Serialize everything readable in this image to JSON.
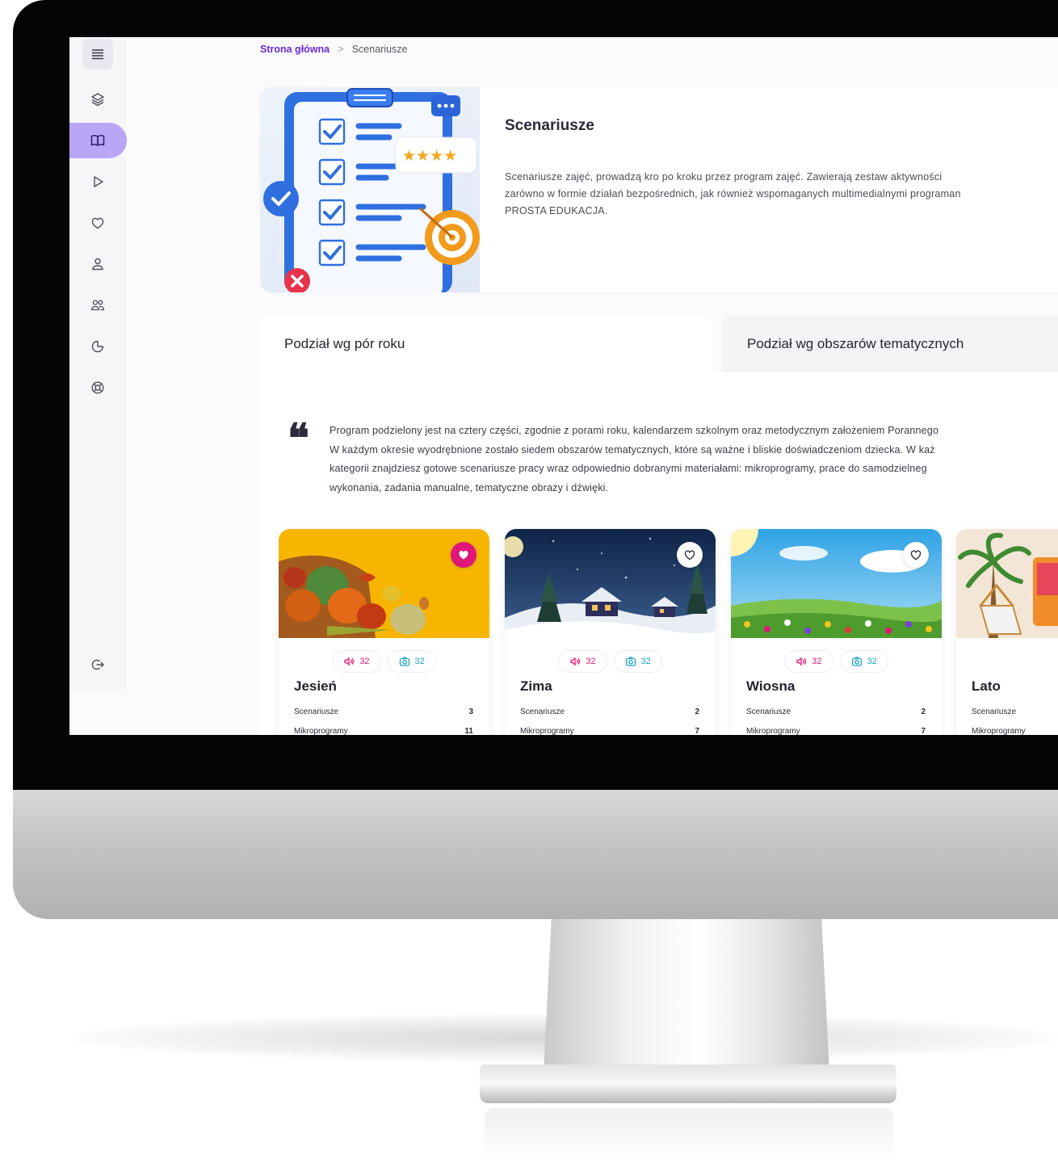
{
  "breadcrumb": {
    "home": "Strona główna",
    "separator": ">",
    "current": "Scenariusze"
  },
  "sidebar": {
    "items": [
      {
        "icon": "menu-icon"
      },
      {
        "icon": "layers-icon"
      },
      {
        "icon": "book-icon",
        "active": true
      },
      {
        "icon": "play-icon"
      },
      {
        "icon": "heart-icon"
      },
      {
        "icon": "user-icon"
      },
      {
        "icon": "users-icon"
      },
      {
        "icon": "pie-chart-icon"
      },
      {
        "icon": "lifebuoy-icon"
      }
    ],
    "logout_icon": "logout-icon",
    "active_color": "#b9a6f4"
  },
  "hero": {
    "title": "Scenariusze",
    "description": "Scenariusze zajęć, prowadzą kro po kroku przez program zajęć. Zawierają zestaw aktywności\nzarówno w formie działań bezpośrednich, jak również wspomaganych multimedialnymi programan\nPROSTA EDUKACJA."
  },
  "tabs": [
    {
      "label": "Podział wg pór roku",
      "active": true
    },
    {
      "label": "Podział wg obszarów tematycznych",
      "active": false
    }
  ],
  "quote": {
    "mark": "66",
    "text": "Program podzielony jest na cztery części, zgodnie z porami roku, kalendarzem szkolnym oraz metodycznym założeniem Porannego\nW każdym okresie wyodrębnione zostało siedem obszarów tematycznych, które są ważne i bliskie doświadczeniom dziecka. W każ\nkategorii znajdziesz gotowe scenariusze pracy wraz odpowiednio dobranymi materiałami: mikroprogramy, prace do samodzielneg\nwykonania, zadania manualne, tematyczne obrazy i dźwięki."
  },
  "cards": [
    {
      "title": "Jesień",
      "favorite": true,
      "audio_count": "32",
      "photo_count": "32",
      "stat1_label": "Scenariusze",
      "stat1_value": "3",
      "stat2_label": "Mikroprogramy",
      "stat2_value": "11"
    },
    {
      "title": "Zima",
      "favorite": false,
      "audio_count": "32",
      "photo_count": "32",
      "stat1_label": "Scenariusze",
      "stat1_value": "2",
      "stat2_label": "Mikroprogramy",
      "stat2_value": "7"
    },
    {
      "title": "Wiosna",
      "favorite": false,
      "audio_count": "32",
      "photo_count": "32",
      "stat1_label": "Scenariusze",
      "stat1_value": "2",
      "stat2_label": "Mikroprogramy",
      "stat2_value": "7"
    },
    {
      "title": "Lato",
      "favorite": false,
      "audio_count": "",
      "photo_count": "",
      "stat1_label": "Scenariusze",
      "stat1_value": "",
      "stat2_label": "Mikroprogramy",
      "stat2_value": ""
    }
  ],
  "colors": {
    "accent": "#6b2bd9",
    "favorite": "#e0177a",
    "audio": "#e0177a",
    "photo": "#1ba3c9"
  }
}
